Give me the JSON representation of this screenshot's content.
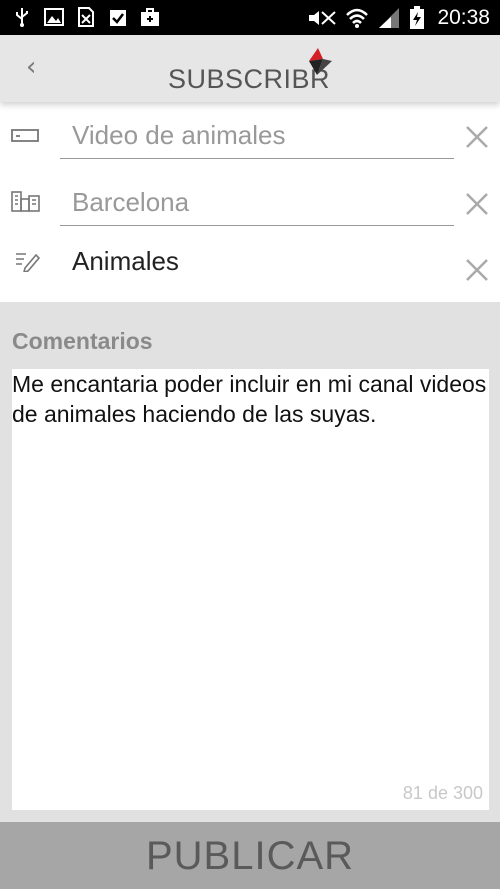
{
  "status_bar": {
    "time": "20:38",
    "left_icons": [
      "usb-icon",
      "image-icon",
      "sim-off-icon",
      "clipboard-check-icon",
      "briefcase-icon"
    ],
    "right_icons": [
      "no-sound-icon",
      "wifi-icon",
      "signal-icon",
      "battery-charging-icon"
    ]
  },
  "appbar": {
    "back_glyph": "‹",
    "logo_text": "SUBSCRIBR",
    "logo_accent_color": "#d32027"
  },
  "form": {
    "rows": [
      {
        "icon": "title-field-icon",
        "text": "Video de animales",
        "is_placeholder": true
      },
      {
        "icon": "city-icon",
        "text": "Barcelona",
        "is_placeholder": true
      },
      {
        "icon": "category-icon",
        "text": "Animales",
        "is_placeholder": false
      }
    ]
  },
  "comments": {
    "label": "Comentarios",
    "text": "Me encantaria poder incluir en mi canal videos de animales haciendo de las suyas.",
    "counter": "81 de 300"
  },
  "publish": {
    "label": "PUBLICAR"
  }
}
